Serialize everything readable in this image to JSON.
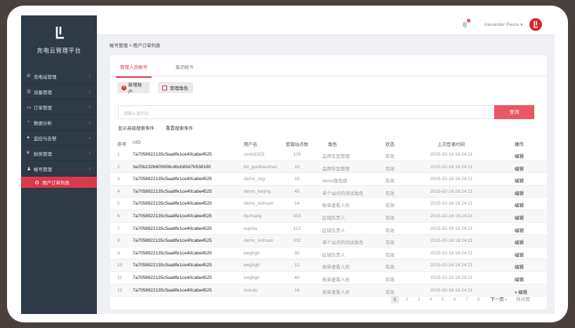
{
  "app": {
    "name": "充电云管理平台"
  },
  "sidebar": {
    "items": [
      {
        "label": "充电站管理",
        "icon": "bar-chart-icon",
        "glyph": "ılı"
      },
      {
        "label": "设备管理",
        "icon": "list-icon",
        "glyph": "☰"
      },
      {
        "label": "订单管理",
        "icon": "card-icon",
        "glyph": "▭"
      },
      {
        "label": "数据分析",
        "icon": "pie-chart-icon",
        "glyph": "◔"
      },
      {
        "label": "监控与告警",
        "icon": "chat-icon",
        "glyph": "●"
      },
      {
        "label": "财务管理",
        "icon": "yen-icon",
        "glyph": "¥"
      },
      {
        "label": "帐号管理",
        "icon": "user-icon",
        "glyph": "♟"
      }
    ],
    "active_sub": "用户订单列表"
  },
  "topbar": {
    "notification_count": "3",
    "user_name": "Alexander Pierce ▾",
    "avatar_icon": "brand-logo-icon"
  },
  "breadcrumb": "帐号管理 > 用户订单列表",
  "tabs": {
    "active": "管理人员帐号",
    "other": "集团帐号"
  },
  "toolbar": {
    "add_label": "新增账户",
    "role_label": "管理角色"
  },
  "search": {
    "placeholder": "请输入操作ID",
    "button": "查询",
    "advanced": "显示高级搜索条件",
    "reset": "重置搜索条件"
  },
  "table": {
    "headers": [
      "序号",
      "UID",
      "用户名",
      "管辖站点数",
      "角色",
      "状态",
      "上次登录时间",
      "操作"
    ],
    "rows": [
      [
        "1",
        "7a7058922135c5aa8fe1ce40cabe4525",
        "ceshi2323",
        "126",
        "品牌车型管理",
        "有效",
        "2015-02-16  16:24:21",
        "编辑"
      ],
      [
        "2",
        "3e25b232b605656c4bcb83d7b538180",
        "bd_guobiaozhan",
        "10",
        "品牌车型管理",
        "有效",
        "2015-02-16  16:24:21",
        "编辑"
      ],
      [
        "3",
        "7a7058922135c5aa8fe1ce40cabe4525",
        "demo_csg",
        "23",
        "demo角色组",
        "有效",
        "2015-02-16  16:24:21",
        "编辑"
      ],
      [
        "4",
        "7a7058922135c5aa8fe1ce40cabe4525",
        "demo_beijing",
        "45",
        "单个站点的测试角色",
        "有效",
        "2015-02-16  16:24:21",
        "编辑"
      ],
      [
        "5",
        "7a7058922135c5aa8fe1ce40cabe4525",
        "demo_sichuan",
        "14",
        "账单查看人员",
        "有效",
        "2015-02-16  16:24:21",
        "编辑"
      ],
      [
        "6",
        "7a7058922135c5aa8fe1ce40cabe4525",
        "lilyzhang",
        "103",
        "区域负责人",
        "有效",
        "2015-02-16  16:24:21",
        "编辑"
      ],
      [
        "7",
        "7a7058922135c5aa8fe1ce40cabe4525",
        "sophia",
        "123",
        "区域负责人",
        "有效",
        "2015-02-16  16:24:21",
        "编辑"
      ],
      [
        "8",
        "7a7058922135c5aa8fe1ce40cabe4525",
        "demo_sichuan",
        "102",
        "单个站点的测试角色",
        "有效",
        "2015-02-16  16:24:21",
        "编辑"
      ],
      [
        "9",
        "7a7058922135c5aa8fe1ce40cabe4525",
        "weghgh",
        "30",
        "区域负责人",
        "有效",
        "2015-02-16  16:24:21",
        "编辑"
      ],
      [
        "10",
        "7a7058922135c5aa8fe1ce40cabe4525",
        "weghgh",
        "12",
        "账单查看人员",
        "有效",
        "2015-02-16  16:24:21",
        "编辑"
      ],
      [
        "11",
        "7a7058922135c5aa8fe1ce40cabe4525",
        "weghgh",
        "40",
        "账单查看人员",
        "有效",
        "2015-02-16  16:24:21",
        "编辑"
      ],
      [
        "12",
        "7a7058922135c5aa8fe1ce40cabe4525",
        "morulu",
        "14",
        "账单查看人员",
        "有效",
        "2015-02-16  16:24:21",
        "v  编辑"
      ]
    ]
  },
  "pagination": {
    "pages": [
      "1",
      "2",
      "3",
      "4",
      "5",
      "6",
      "7",
      "8"
    ],
    "current": "1",
    "next": "下一页 ›",
    "total": "共15页"
  },
  "colors": {
    "accent": "#d73a4a",
    "sidebar": "#2e3a46",
    "search_button": "#e85864"
  }
}
